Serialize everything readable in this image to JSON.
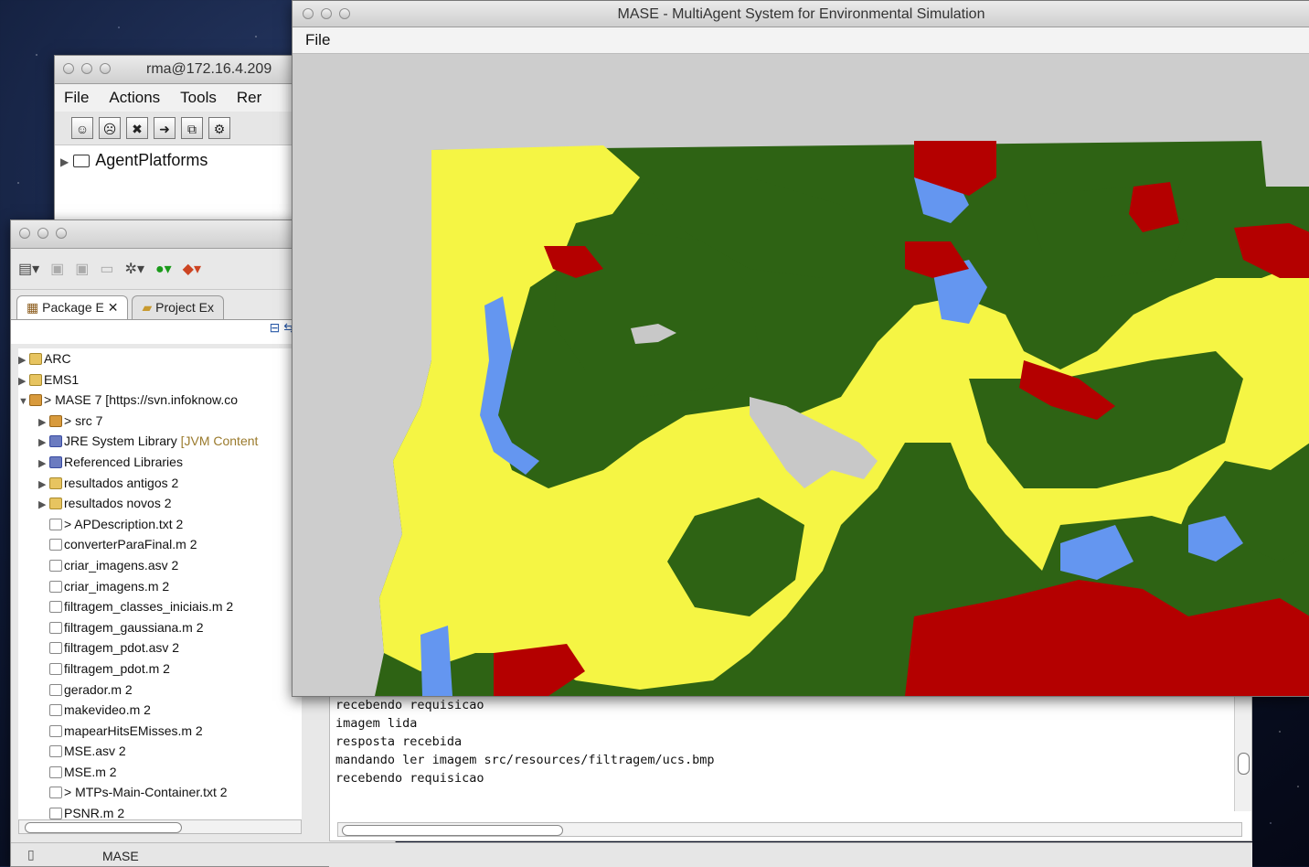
{
  "rma_window": {
    "title": "rma@172.16.4.209",
    "menu": [
      "File",
      "Actions",
      "Tools",
      "Rer"
    ],
    "tree_root": "AgentPlatforms"
  },
  "eclipse": {
    "tabs": [
      "Package E",
      "Project Ex"
    ],
    "tree": [
      {
        "label": "ARC",
        "icon": "project-folder-icon",
        "arrow": "▶",
        "indent": 0
      },
      {
        "label": "EMS1",
        "icon": "project-folder-icon",
        "arrow": "▶",
        "indent": 0
      },
      {
        "label": "> MASE 7 [https://svn.infoknow.co",
        "icon": "svn-project-icon",
        "arrow": "▼",
        "indent": 0
      },
      {
        "label": "> src 7",
        "icon": "source-folder-icon",
        "arrow": "▶",
        "indent": 1
      },
      {
        "label": "JRE System Library",
        "hint": " [JVM Content",
        "icon": "library-icon",
        "arrow": "▶",
        "indent": 1
      },
      {
        "label": "Referenced Libraries",
        "icon": "library-icon",
        "arrow": "▶",
        "indent": 1
      },
      {
        "label": "resultados antigos 2",
        "icon": "folder-icon",
        "arrow": "▶",
        "indent": 1
      },
      {
        "label": "resultados novos 2",
        "icon": "folder-icon",
        "arrow": "▶",
        "indent": 1
      },
      {
        "label": "> APDescription.txt 2",
        "icon": "file-icon",
        "arrow": "",
        "indent": 1
      },
      {
        "label": "converterParaFinal.m 2",
        "icon": "file-icon",
        "arrow": "",
        "indent": 1
      },
      {
        "label": "criar_imagens.asv 2",
        "icon": "file-icon",
        "arrow": "",
        "indent": 1
      },
      {
        "label": "criar_imagens.m 2",
        "icon": "file-icon",
        "arrow": "",
        "indent": 1
      },
      {
        "label": "filtragem_classes_iniciais.m 2",
        "icon": "file-icon",
        "arrow": "",
        "indent": 1
      },
      {
        "label": "filtragem_gaussiana.m 2",
        "icon": "file-icon",
        "arrow": "",
        "indent": 1
      },
      {
        "label": "filtragem_pdot.asv 2",
        "icon": "file-icon",
        "arrow": "",
        "indent": 1
      },
      {
        "label": "filtragem_pdot.m 2",
        "icon": "file-icon",
        "arrow": "",
        "indent": 1
      },
      {
        "label": "gerador.m 2",
        "icon": "file-icon",
        "arrow": "",
        "indent": 1
      },
      {
        "label": "makevideo.m 2",
        "icon": "file-icon",
        "arrow": "",
        "indent": 1
      },
      {
        "label": "mapearHitsEMisses.m 2",
        "icon": "file-icon",
        "arrow": "",
        "indent": 1
      },
      {
        "label": "MSE.asv 2",
        "icon": "file-icon",
        "arrow": "",
        "indent": 1
      },
      {
        "label": "MSE.m 2",
        "icon": "file-icon",
        "arrow": "",
        "indent": 1
      },
      {
        "label": "> MTPs-Main-Container.txt 2",
        "icon": "file-icon",
        "arrow": "",
        "indent": 1
      },
      {
        "label": "PSNR.m 2",
        "icon": "file-icon",
        "arrow": "",
        "indent": 1
      }
    ],
    "status_label": "MASE"
  },
  "console": {
    "lines": [
      "recebendo requisicao",
      "imagem lida",
      "resposta recebida",
      "mandando ler imagem src/resources/filtragem/ucs.bmp",
      "recebendo requisicao"
    ]
  },
  "mase": {
    "title": "MASE - MultiAgent System for Environmental Simulation",
    "menu_file": "File",
    "map_colors": {
      "forest": "#2e6314",
      "urban": "#f5f544",
      "water": "#6496f0",
      "degraded": "#b40000",
      "lake": "#c8c8c8"
    }
  }
}
